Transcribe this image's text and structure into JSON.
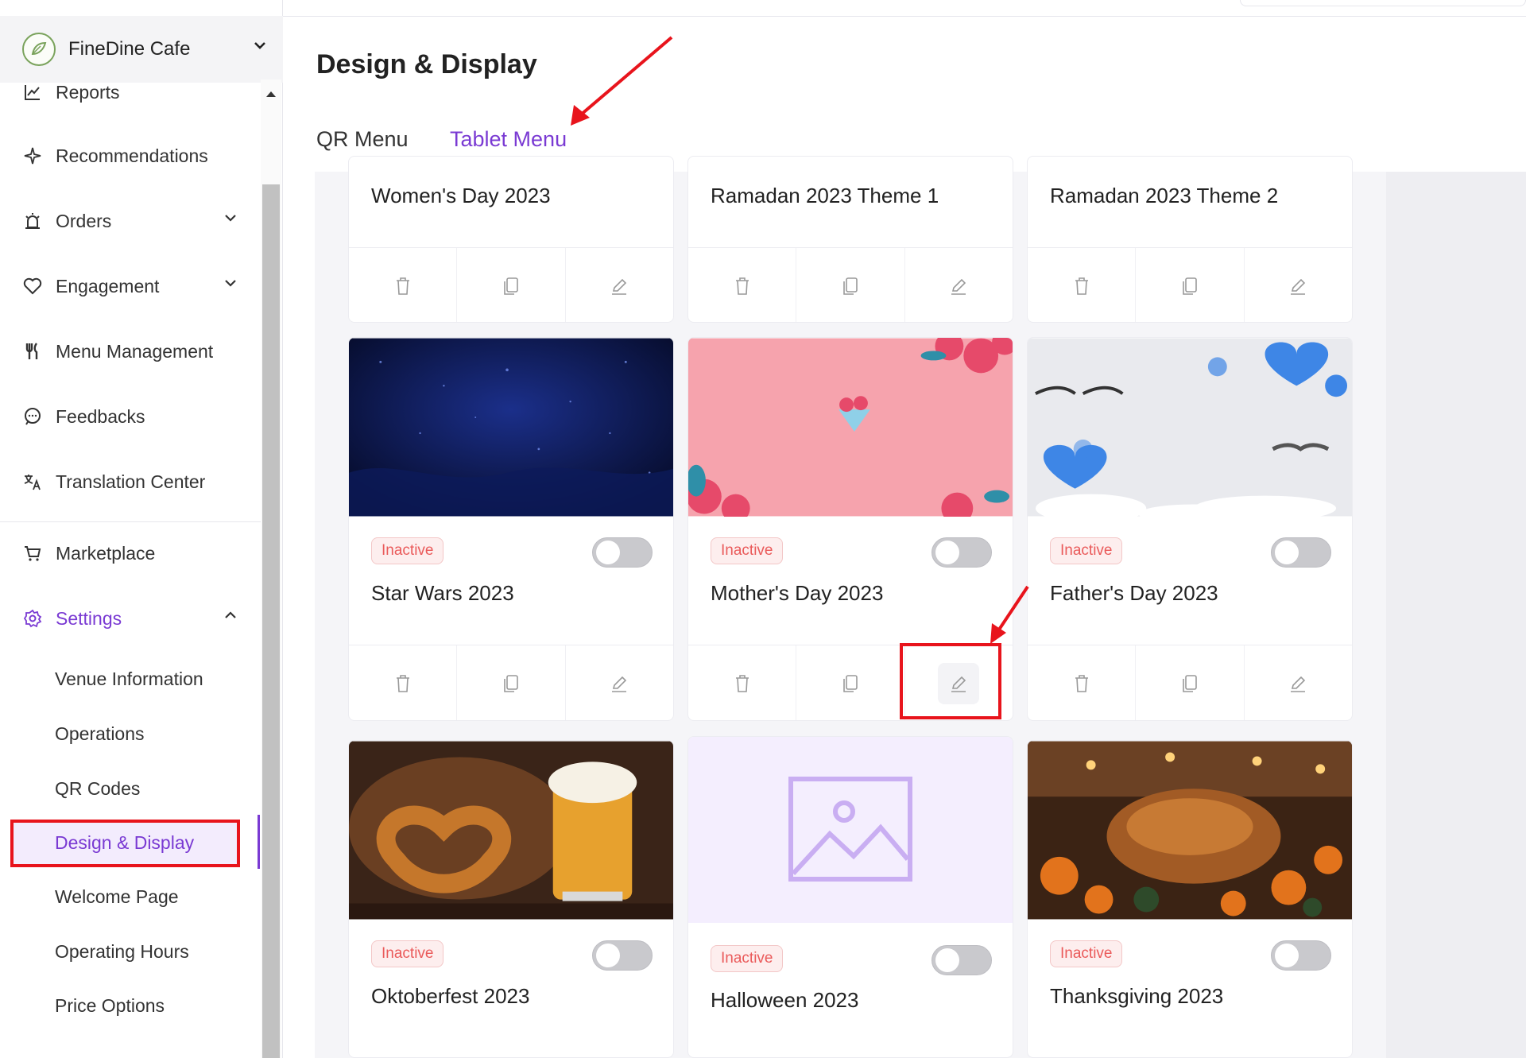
{
  "brand": {
    "name": "FineDine Cafe"
  },
  "sidebar": {
    "items": [
      {
        "label": "Reports",
        "icon": "chart-line-icon"
      },
      {
        "label": "Recommendations",
        "icon": "sparkle-icon"
      },
      {
        "label": "Orders",
        "icon": "alarm-bell-icon"
      },
      {
        "label": "Engagement",
        "icon": "heart-icon"
      },
      {
        "label": "Menu Management",
        "icon": "fork-knife-icon"
      },
      {
        "label": "Feedbacks",
        "icon": "chat-bubble-icon"
      },
      {
        "label": "Translation Center",
        "icon": "translate-icon"
      },
      {
        "label": "Marketplace",
        "icon": "cart-icon"
      },
      {
        "label": "Settings",
        "icon": "gear-icon"
      }
    ],
    "settings_sub": [
      {
        "label": "Venue Information"
      },
      {
        "label": "Operations"
      },
      {
        "label": "QR Codes"
      },
      {
        "label": "Design & Display"
      },
      {
        "label": "Welcome Page"
      },
      {
        "label": "Operating Hours"
      },
      {
        "label": "Price Options"
      }
    ],
    "accent": "#7a3ad3"
  },
  "header": {
    "title": "Design & Display",
    "tabs": [
      {
        "label": "QR Menu"
      },
      {
        "label": "Tablet Menu",
        "active": true
      }
    ]
  },
  "themes": {
    "status_label": "Inactive",
    "row1": [
      {
        "title": "Women's Day 2023"
      },
      {
        "title": "Ramadan 2023 Theme 1"
      },
      {
        "title": "Ramadan 2023 Theme 2"
      }
    ],
    "row2": [
      {
        "title": "Star Wars 2023",
        "image": "starfield-image"
      },
      {
        "title": "Mother's Day 2023",
        "image": "pink-flowers-image"
      },
      {
        "title": "Father's Day 2023",
        "image": "blue-hearts-image"
      }
    ],
    "row3": [
      {
        "title": "Oktoberfest 2023",
        "image": "pretzel-beer-image"
      },
      {
        "title": "Halloween 2023",
        "image": "image-placeholder-icon"
      },
      {
        "title": "Thanksgiving 2023",
        "image": "roast-turkey-image"
      }
    ]
  },
  "annotation_color": "#e8141c"
}
